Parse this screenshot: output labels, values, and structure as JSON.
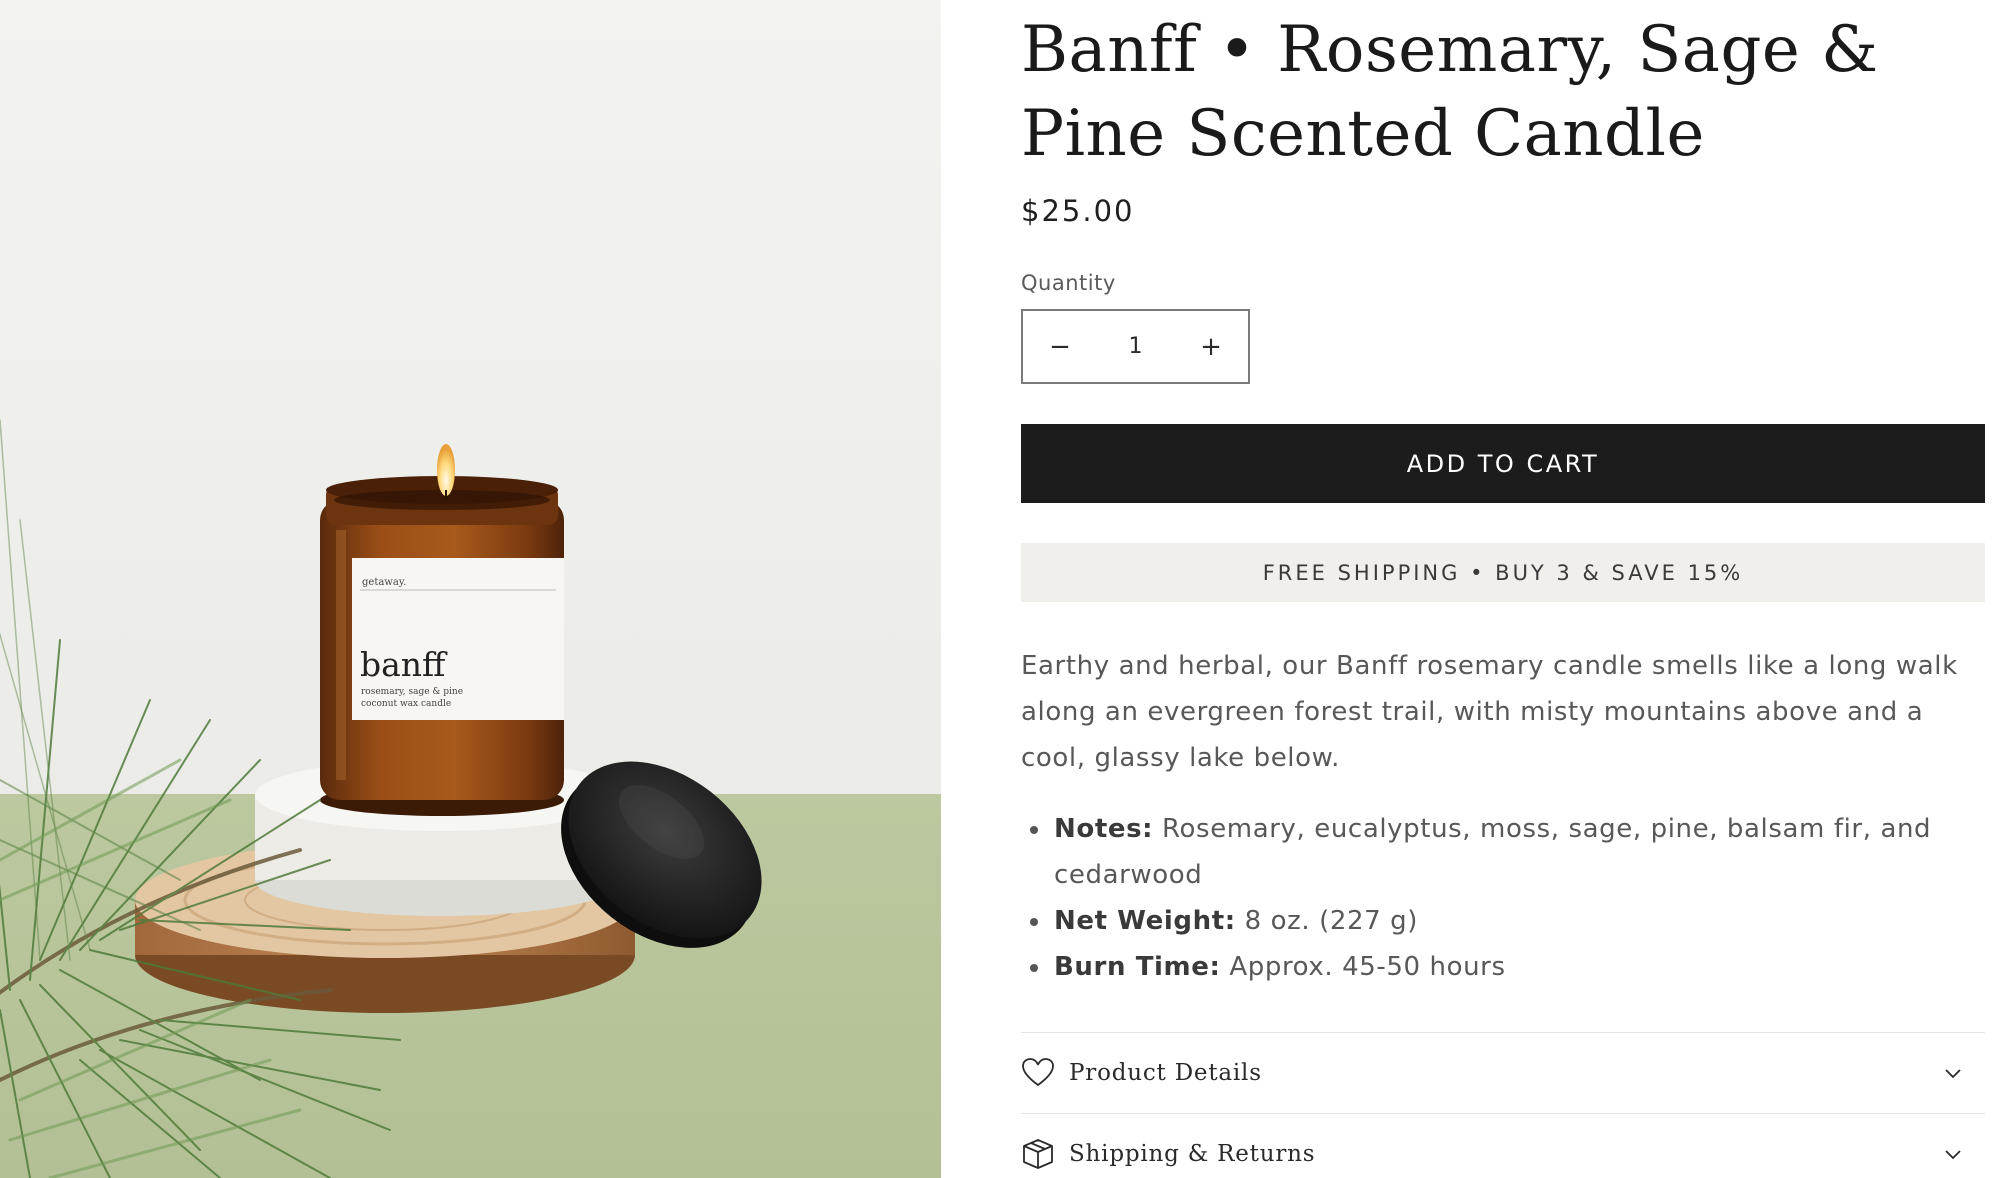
{
  "product": {
    "title": "Banff • Rosemary, Sage & Pine Scented Candle",
    "price": "$25.00",
    "image": {
      "label_brand": "getaway.",
      "label_name": "banff",
      "label_line1": "rosemary, sage & pine",
      "label_line2": "coconut wax candle"
    }
  },
  "quantity": {
    "label": "Quantity",
    "value": "1",
    "decrease_symbol": "−",
    "increase_symbol": "+"
  },
  "cart": {
    "add_label": "ADD TO CART"
  },
  "promo": {
    "text": "FREE SHIPPING • BUY 3 & SAVE 15%"
  },
  "description": "Earthy and herbal, our Banff rosemary candle smells like a long walk along an evergreen forest trail, with misty mountains above and a cool, glassy lake below.",
  "details": [
    {
      "label": "Notes:",
      "value": "Rosemary, eucalyptus, moss, sage, pine, balsam fir, and cedarwood"
    },
    {
      "label": "Net Weight:",
      "value": "8 oz. (227 g)"
    },
    {
      "label": "Burn Time:",
      "value": "Approx. 45-50 hours"
    }
  ],
  "accordions": [
    {
      "label": "Product Details",
      "icon": "heart-icon"
    },
    {
      "label": "Shipping & Returns",
      "icon": "box-icon"
    }
  ],
  "colors": {
    "button_bg": "#1c1c1c",
    "promo_bg": "#f0efeb",
    "backdrop_green": "#b9c59c",
    "jar_amber": "#8a4413"
  }
}
